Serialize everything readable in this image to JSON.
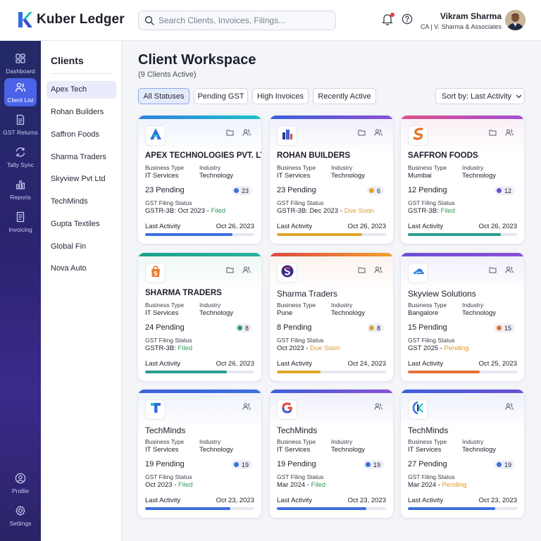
{
  "app": {
    "name": "Kuber Ledger"
  },
  "search": {
    "placeholder": "Search Clients, Invoices, Filings..."
  },
  "user": {
    "name": "Vikram Sharma",
    "role": "CA | V. Sharma & Associates"
  },
  "nav": [
    {
      "label": "Dashboard",
      "icon": "dashboard-icon"
    },
    {
      "label": "Client List",
      "icon": "users-icon",
      "active": true
    },
    {
      "label": "GST Returns",
      "icon": "document-icon"
    },
    {
      "label": "Tally Sync",
      "icon": "sync-icon"
    },
    {
      "label": "Reports",
      "icon": "bar-chart-icon"
    },
    {
      "label": "Invoicing",
      "icon": "invoice-icon"
    },
    {
      "label": "Profile",
      "icon": "profile-icon"
    },
    {
      "label": "Settings",
      "icon": "gear-icon"
    }
  ],
  "clients_panel": {
    "title": "Clients",
    "items": [
      "Apex Tech",
      "Rohan Builders",
      "Saffron Foods",
      "Sharma Traders",
      "Skyview Pvt Ltd",
      "TechMinds",
      "Gupta Textiles",
      "Global Fin",
      "Nova Auto"
    ],
    "active_index": 0
  },
  "main": {
    "title": "Client Workspace",
    "subtitle": "(9 Clients Active)",
    "filters": [
      "All Statuses",
      "Pending GST",
      "High Invoices",
      "Recently Active"
    ],
    "sort": "Sort by: Last Activity"
  },
  "labels": {
    "business_type": "Business Type",
    "industry": "Industry",
    "gst_filing_status": "GST Filing Status",
    "last_activity": "Last Activity"
  },
  "cards": [
    {
      "name": "APEX TECHNOLOGIES PVT. LTD.",
      "business_type": "IT Services",
      "industry": "Technology",
      "pending": "23 Pending",
      "badge": "23",
      "gst_period": "GSTR-3B: Oct 2023 - ",
      "gst_status": "Filed",
      "last_activity": "Oct 26, 2023",
      "progress": 0.8,
      "accent": "#3d6fe0",
      "status_color": "#2e9a5a",
      "dot_color": "#3d6fe0",
      "bar": "linear-gradient(90deg,#2f7fe0,#1cc2c9)",
      "tint": "#eef3fc",
      "logo_icon": "apex-logo-icon",
      "bold": true
    },
    {
      "name": "ROHAN BUILDERS",
      "business_type": "IT Services",
      "industry": "Technology",
      "pending": "23 Pending",
      "badge": "6",
      "gst_period": "GSTR-3B: Dec 2023 - ",
      "gst_status": "Due Soon",
      "last_activity": "Oct 26, 2023",
      "progress": 0.78,
      "accent": "#e0a62b",
      "status_color": "#e39a1e",
      "dot_color": "#e8a12a",
      "bar": "linear-gradient(90deg,#3b5fd9,#8b4fd6)",
      "tint": "#f1f0fb",
      "logo_icon": "building-logo-icon",
      "bold": true
    },
    {
      "name": "SAFFRON FOODS",
      "business_type": "Mumbai",
      "industry": "Technology",
      "pending": "12 Pending",
      "badge": "12",
      "gst_period": "GSTR-3B: ",
      "gst_status": "Filed",
      "last_activity": "Oct 26, 2023",
      "progress": 0.85,
      "accent": "#2a9d8f",
      "status_color": "#2e9a5a",
      "dot_color": "#6b4fd6",
      "bar": "linear-gradient(90deg,#e04f8a,#a34fd6)",
      "tint": "#faf0f6",
      "logo_icon": "saffron-logo-icon",
      "bold": true
    },
    {
      "name": "SHARMA TRADERS",
      "business_type": "IT Services",
      "industry": "Technology",
      "pending": "24 Pending",
      "badge": "8",
      "gst_period": "GSTR-3B: ",
      "gst_status": "Filed",
      "last_activity": "Oct 26, 2023",
      "progress": 0.75,
      "accent": "#2a9d8f",
      "status_color": "#2e9a5a",
      "dot_color": "#2e9a6a",
      "bar": "linear-gradient(90deg,#1c9f88,#26b3a0)",
      "tint": "#eef8f5",
      "logo_icon": "shopping-bag-logo-icon",
      "bold": true
    },
    {
      "name": "Sharma Traders",
      "business_type": "Pune",
      "industry": "Technology",
      "pending": "8 Pending",
      "badge": "8",
      "gst_period": "Oct 2023 - ",
      "gst_status": "Due Soon",
      "last_activity": "Oct 24, 2023",
      "progress": 0.4,
      "accent": "#e0a62b",
      "status_color": "#e39a1e",
      "dot_color": "#e8a12a",
      "bar": "linear-gradient(90deg,#e0463c,#f0a030)",
      "tint": "#fdf3ee",
      "logo_icon": "s-swirl-logo-icon",
      "bold": false
    },
    {
      "name": "Skyview Solutions",
      "business_type": "Bangalore",
      "industry": "Technology",
      "pending": "15 Pending",
      "badge": "15",
      "gst_period": "GST 2025 - ",
      "gst_status": "Pending",
      "last_activity": "Oct 25, 2023",
      "progress": 0.66,
      "accent": "#e8703a",
      "status_color": "#e39a1e",
      "dot_color": "#e8703a",
      "bar": "linear-gradient(90deg,#6b4fd6,#8b4fd6)",
      "tint": "#f2f0fb",
      "logo_icon": "cloud-logo-icon",
      "bold": false
    },
    {
      "name": "TechMinds",
      "business_type": "IT Services",
      "industry": "Technology",
      "pending": "19 Pending",
      "badge": "19",
      "gst_period": "Oct 2023 - ",
      "gst_status": "Filed",
      "last_activity": "Oct 23, 2023",
      "progress": 0.78,
      "accent": "#3d6fe0",
      "status_color": "#2e9a5a",
      "dot_color": "#3d6fe0",
      "bar": "linear-gradient(90deg,#3b5fd9,#3b6fe0)",
      "tint": "#eef2fc",
      "logo_icon": "t-logo-icon",
      "bold": false
    },
    {
      "name": "TechMinds",
      "business_type": "IT Services",
      "industry": "Technology",
      "pending": "19 Pending",
      "badge": "19",
      "gst_period": "Mar 2024 - ",
      "gst_status": "Filed",
      "last_activity": "Oct 23, 2023",
      "progress": 0.82,
      "accent": "#3d6fe0",
      "status_color": "#2e9a5a",
      "dot_color": "#3d6fe0",
      "bar": "linear-gradient(90deg,#3b5fd9,#8b4fd6)",
      "tint": "#f0f0fb",
      "logo_icon": "g-logo-icon",
      "bold": false
    },
    {
      "name": "TechMinds",
      "business_type": "IT Services",
      "industry": "Technology",
      "pending": "27 Pending",
      "badge": "19",
      "gst_period": "Mar 2024 - ",
      "gst_status": "Pending",
      "last_activity": "Oct 23, 2023",
      "progress": 0.8,
      "accent": "#3d6fe0",
      "status_color": "#e39a1e",
      "dot_color": "#3d6fe0",
      "bar": "linear-gradient(90deg,#3b5fd9,#6b4fd6)",
      "tint": "#eff1fb",
      "logo_icon": "k-logo-icon",
      "bold": false
    }
  ]
}
